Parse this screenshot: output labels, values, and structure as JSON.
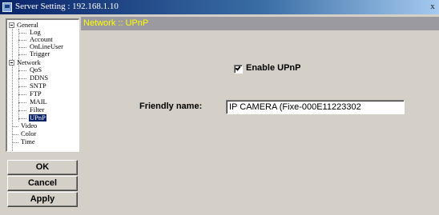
{
  "window": {
    "title": "Server Setting : 192.168.1.10",
    "close_glyph": "x",
    "icon": "app-icon"
  },
  "nav_tree": {
    "groups": [
      {
        "label": "General",
        "expanded": true,
        "children": [
          "Log",
          "Account",
          "OnLineUser",
          "Trigger"
        ]
      },
      {
        "label": "Network",
        "expanded": true,
        "children": [
          "QoS",
          "DDNS",
          "SNTP",
          "FTP",
          "MAIL",
          "Filter",
          "UPnP"
        ]
      }
    ],
    "top_items": [
      "Video",
      "Color",
      "Time"
    ],
    "selected": "UPnP"
  },
  "buttons": {
    "ok": "OK",
    "cancel": "Cancel",
    "apply": "Apply"
  },
  "content": {
    "header": "Network :: UPnP",
    "header_color": "#ffff00",
    "enable_upnp": {
      "label": "Enable UPnP",
      "checked": true
    },
    "friendly_name": {
      "label": "Friendly name:",
      "value": "IP CAMERA (Fixe-000E11223302"
    }
  }
}
